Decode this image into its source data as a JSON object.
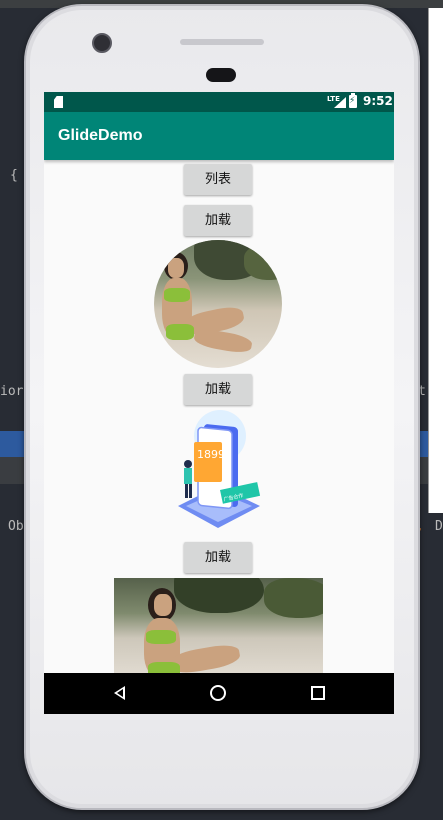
{
  "ide": {
    "brace": "{",
    "line_fragment_left": "ior",
    "line_fragment_right": "t",
    "line_fragment_ob": "Ob",
    "line_fragment_d": "D",
    "comma_mark": ","
  },
  "status_bar": {
    "time": "9:52",
    "network": "LTE"
  },
  "app_bar": {
    "title": "GlideDemo"
  },
  "buttons": {
    "list_label": "列表",
    "load1_label": "加载",
    "load2_label": "加载",
    "load3_label": "加载"
  },
  "illustration": {
    "number": "1899",
    "badge_text": "广告合作"
  },
  "colors": {
    "status_bar": "#00574b",
    "app_bar": "#008577",
    "button_bg": "#d6d7d7",
    "screen_bg": "#fafafa"
  },
  "icons": [
    "sd-card-icon",
    "signal-icon",
    "battery-icon",
    "back-icon",
    "home-icon",
    "recents-icon"
  ]
}
